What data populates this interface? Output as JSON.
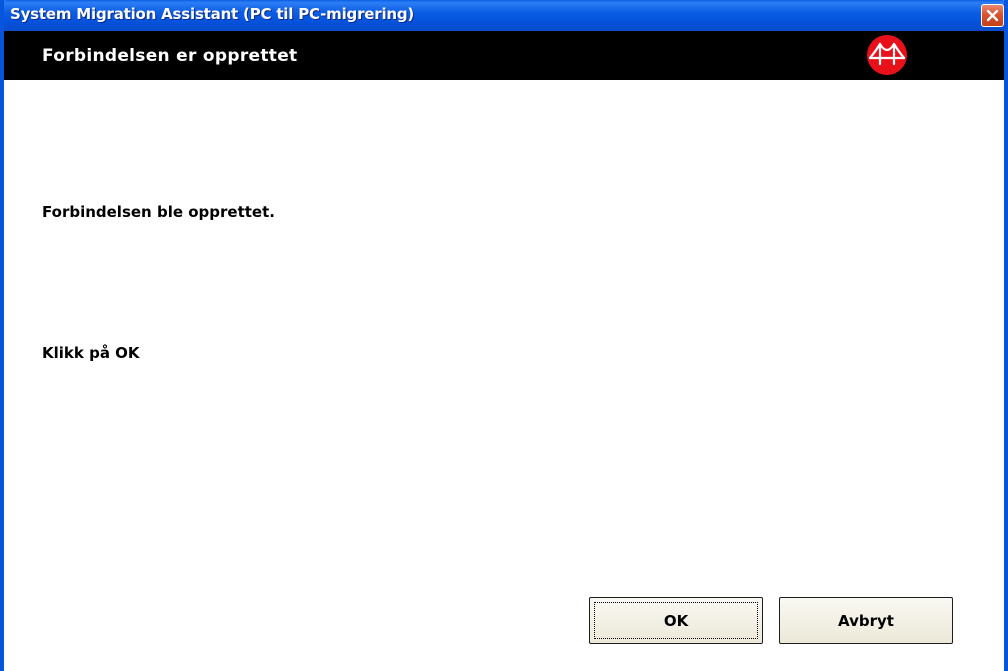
{
  "window": {
    "title": "System Migration Assistant (PC til PC-migrering)",
    "accent_color": "#0855dd",
    "close_icon": "close-icon"
  },
  "header": {
    "title": "Forbindelsen er opprettet",
    "logo_icon": "migration-bridge-logo",
    "logo_color": "#e8111a"
  },
  "content": {
    "message": "Forbindelsen ble opprettet.",
    "instruction": "Klikk på OK"
  },
  "buttons": {
    "ok_label": "OK",
    "cancel_label": "Avbryt"
  }
}
